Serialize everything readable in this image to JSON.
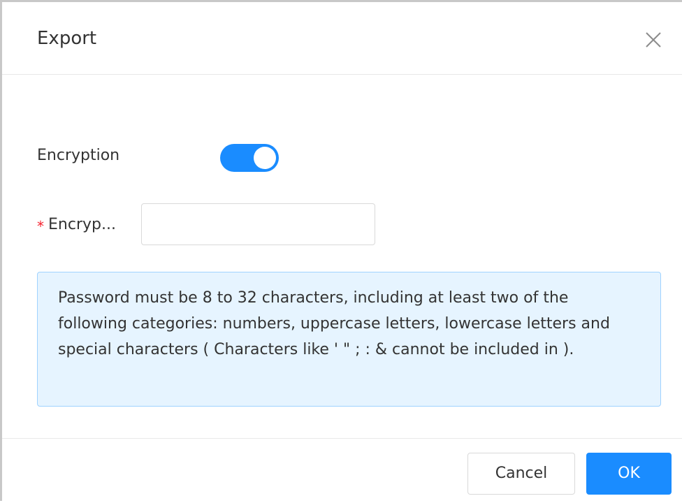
{
  "dialog": {
    "title": "Export",
    "close_icon": "close-icon"
  },
  "form": {
    "encryption_label": "Encryption",
    "encryption_enabled": true,
    "password_required_mark": "*",
    "password_label": "Encryp...",
    "password_value": "",
    "password_placeholder": ""
  },
  "hint": {
    "text": "Password must be 8 to 32 characters, including at least two of the following categories: numbers, uppercase letters, lowercase letters and special characters ( Characters like ' \" ; : & cannot be included in )."
  },
  "footer": {
    "cancel_label": "Cancel",
    "ok_label": "OK"
  },
  "colors": {
    "accent": "#1a8cff",
    "required": "#f5222d",
    "hint_background": "#e6f4ff"
  }
}
